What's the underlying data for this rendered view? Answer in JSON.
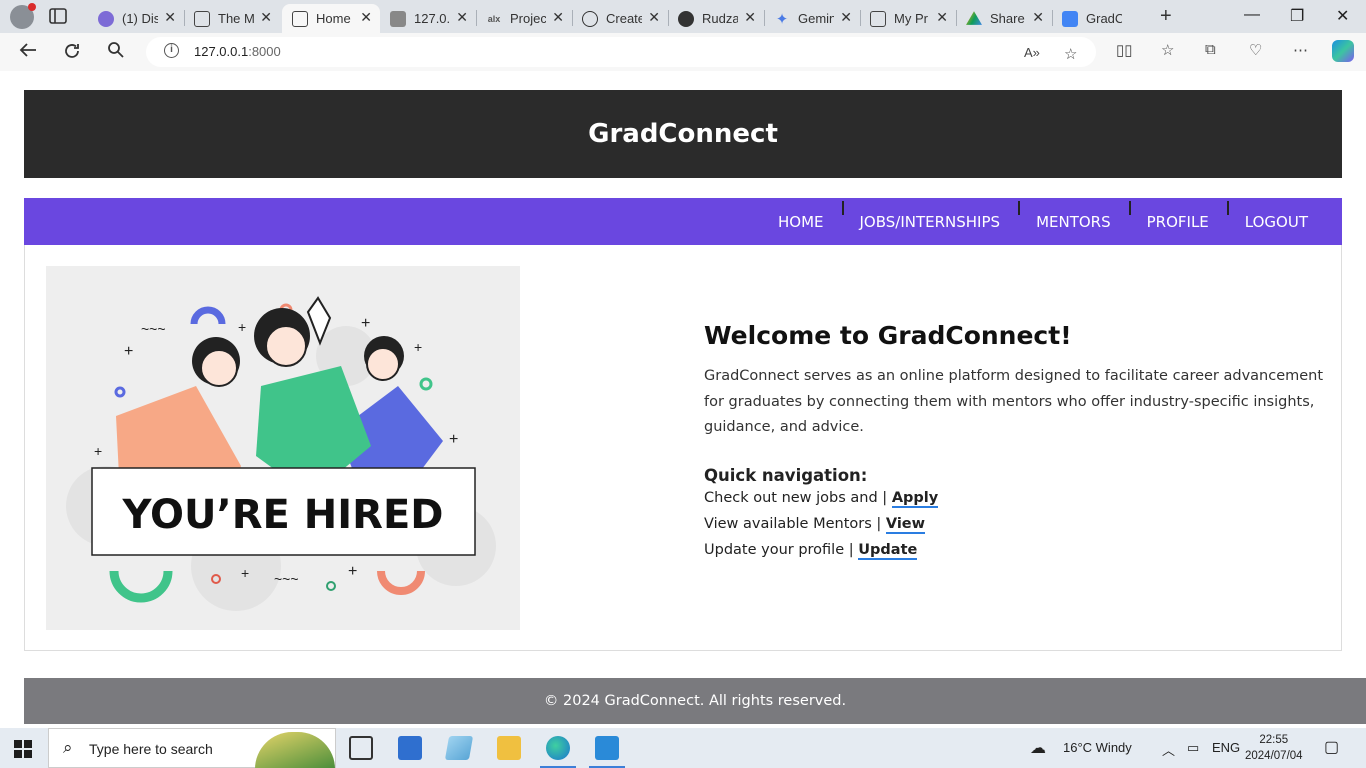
{
  "browser": {
    "tabs": [
      {
        "title": "(1) Dis",
        "icon": "discord-icon",
        "active": false
      },
      {
        "title": "The M",
        "icon": "page-icon",
        "active": false
      },
      {
        "title": "Home",
        "icon": "page-icon",
        "active": true
      },
      {
        "title": "127.0.",
        "icon": "loading-page-icon",
        "active": false
      },
      {
        "title": "Projec",
        "icon": "alx-icon",
        "active": false
      },
      {
        "title": "Create",
        "icon": "openai-icon",
        "active": false
      },
      {
        "title": "Rudza",
        "icon": "github-icon",
        "active": false
      },
      {
        "title": "Gemin",
        "icon": "gemini-icon",
        "active": false
      },
      {
        "title": "My Pr",
        "icon": "page-icon",
        "active": false
      },
      {
        "title": "Share",
        "icon": "google-drive-icon",
        "active": false
      },
      {
        "title": "GradC",
        "icon": "google-docs-icon",
        "active": false
      }
    ],
    "url_host": "127.0.0.1",
    "url_port": ":8000"
  },
  "site": {
    "brand": "GradConnect",
    "nav": [
      "HOME",
      "JOBS/INTERNSHIPS",
      "MENTORS",
      "PROFILE",
      "LOGOUT"
    ],
    "illustration_text": "YOU’RE HIRED",
    "welcome_title": "Welcome to GradConnect!",
    "welcome_body": "GradConnect serves as an online platform designed to facilitate career advancement for graduates by connecting them with mentors who offer industry-specific insights, guidance, and advice.",
    "quick_title": "Quick navigation:",
    "quick_links": [
      {
        "text": "Check out new jobs and |",
        "link": "Apply"
      },
      {
        "text": "View available Mentors |",
        "link": "View"
      },
      {
        "text": "Update your profile |",
        "link": "Update"
      }
    ],
    "footer": "© 2024 GradConnect. All rights reserved."
  },
  "taskbar": {
    "search_placeholder": "Type here to search",
    "weather": "16°C  Windy",
    "language": "ENG",
    "time": "22:55",
    "date": "2024/07/04"
  },
  "colors": {
    "header_bg": "#2b2b2b",
    "nav_bg": "#6a47e0",
    "footer_bg": "#7a7a7e",
    "link_underline": "#2a7de1"
  }
}
